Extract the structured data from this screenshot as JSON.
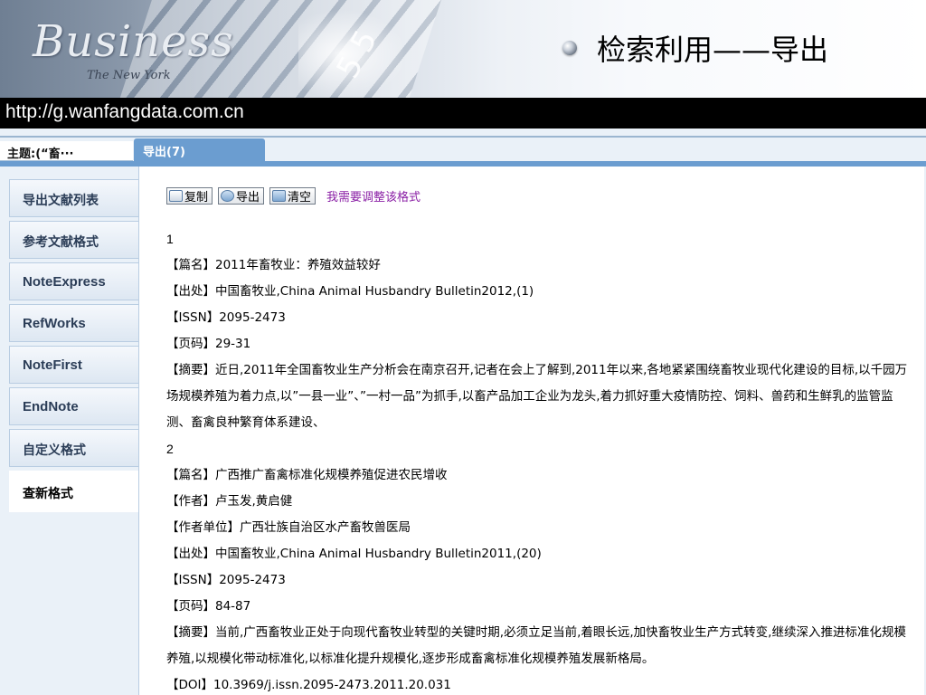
{
  "slide": {
    "title": "检索利用——导出",
    "banner_word": "Business",
    "banner_sub": "The New York",
    "banner_digits": "5  5",
    "url": "http://g.wanfangdata.com.cn"
  },
  "header": {
    "subject_label": "主题:(“畜···",
    "export_tab": "导出(7)"
  },
  "sidebar": {
    "items": [
      {
        "label": "导出文献列表"
      },
      {
        "label": "参考文献格式"
      },
      {
        "label": "NoteExpress"
      },
      {
        "label": "RefWorks"
      },
      {
        "label": "NoteFirst"
      },
      {
        "label": "EndNote"
      },
      {
        "label": "自定义格式"
      },
      {
        "label": "查新格式"
      }
    ]
  },
  "toolbar": {
    "copy_label": "复制",
    "export_label": "导出",
    "clear_label": "清空",
    "adjust_format_link": "我需要调整该格式",
    "icons": [
      "copy-icon",
      "export-icon",
      "clear-icon"
    ]
  },
  "records": [
    {
      "index": "1",
      "lines": [
        "【篇名】2011年畜牧业：养殖效益较好",
        "【出处】中国畜牧业,China Animal Husbandry Bulletin2012,(1)",
        "【ISSN】2095-2473",
        "【页码】29-31"
      ],
      "abstract": "【摘要】近日,2011年全国畜牧业生产分析会在南京召开,记者在会上了解到,2011年以来,各地紧紧围绕畜牧业现代化建设的目标,以千园万场规模养殖为着力点,以”一县一业”、”一村一品”为抓手,以畜产品加工企业为龙头,着力抓好重大疫情防控、饲料、兽药和生鲜乳的监管监测、畜禽良种繁育体系建设、"
    },
    {
      "index": "2",
      "lines": [
        "【篇名】广西推广畜禽标准化规模养殖促进农民增收",
        "【作者】卢玉发,黄启健",
        "【作者单位】广西壮族自治区水产畜牧兽医局",
        "【出处】中国畜牧业,China Animal Husbandry Bulletin2011,(20)",
        "【ISSN】2095-2473",
        "【页码】84-87"
      ],
      "abstract": "【摘要】当前,广西畜牧业正处于向现代畜牧业转型的关键时期,必须立足当前,着眼长远,加快畜牧业生产方式转变,继续深入推进标准化规模养殖,以规模化带动标准化,以标准化提升规模化,逐步形成畜禽标准化规模养殖发展新格局。",
      "doi": "【DOI】10.3969/j.issn.2095-2473.2011.20.031"
    }
  ],
  "colors": {
    "tab_blue": "#6b9dd0",
    "link_purple": "#8a1fa5",
    "url_bar": "#000000"
  }
}
